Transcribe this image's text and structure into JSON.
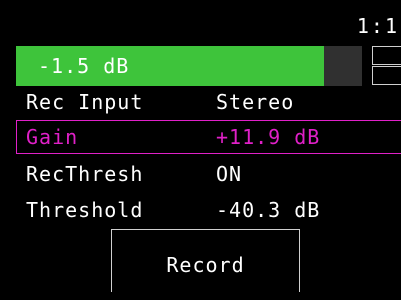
{
  "status": {
    "ratio_label": "1:1"
  },
  "meter": {
    "level_label": "-1.5 dB",
    "fill_fraction": 0.89,
    "colors": {
      "fill": "#3ec43b",
      "track": "#303030"
    }
  },
  "params": [
    {
      "label": "Rec Input",
      "value": "Stereo",
      "selected": false
    },
    {
      "label": "Gain",
      "value": "+11.9 dB",
      "selected": true
    },
    {
      "label": "RecThresh",
      "value": "ON",
      "selected": false
    },
    {
      "label": "Threshold",
      "value": "-40.3 dB",
      "selected": false
    }
  ],
  "record_button": {
    "label": "Record"
  },
  "colors": {
    "background": "#000000",
    "text": "#ffffff",
    "selection": "#e020c8"
  }
}
